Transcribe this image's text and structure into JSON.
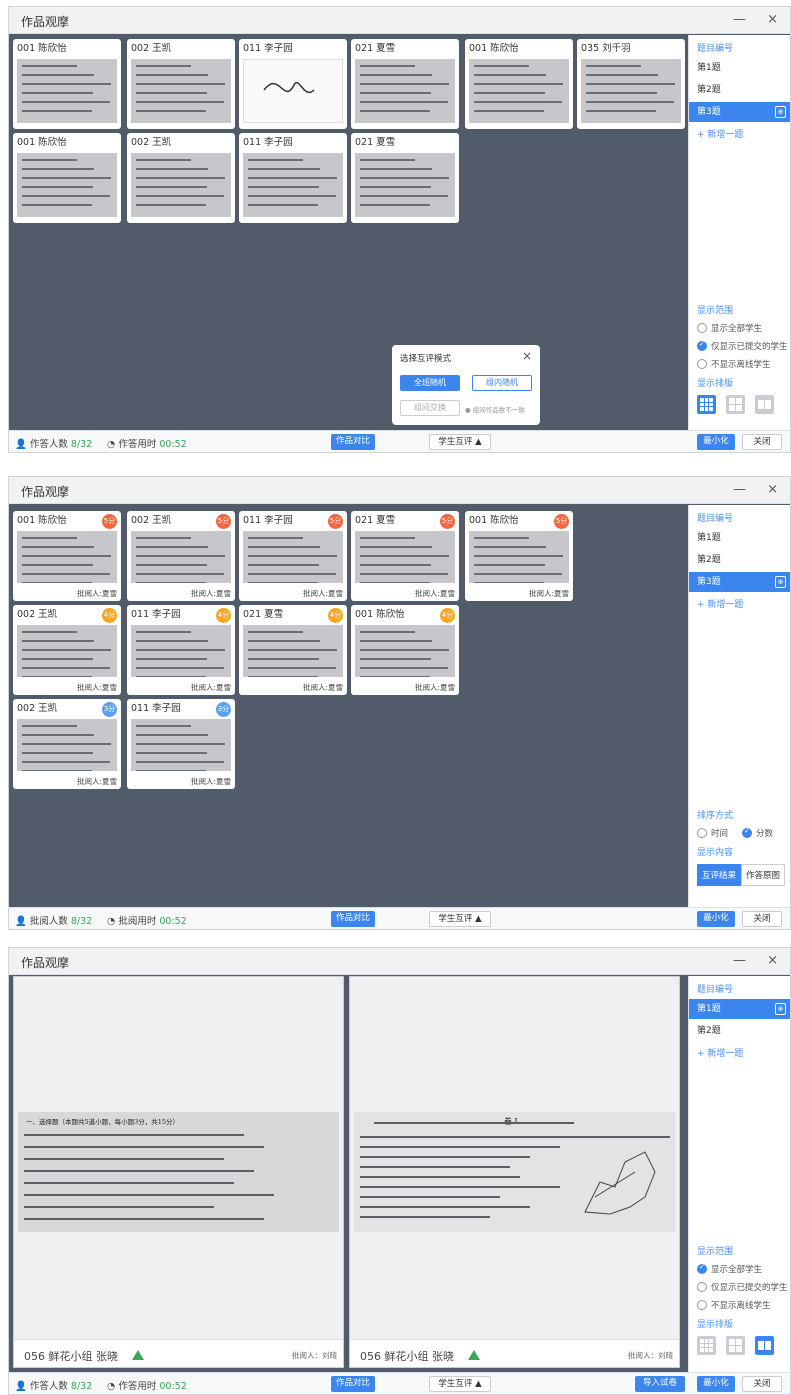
{
  "window": {
    "title": "作品观摩",
    "minimize": "—",
    "close": "×"
  },
  "p1": {
    "cards": [
      {
        "label": "001 陈欣怡"
      },
      {
        "label": "002 王凯"
      },
      {
        "label": "011 李子园"
      },
      {
        "label": "021 夏雪"
      },
      {
        "label": "001 陈欣怡"
      },
      {
        "label": "035 刘千羽"
      },
      {
        "label": "001 陈欣怡"
      },
      {
        "label": "002 王凯"
      },
      {
        "label": "011 李子园"
      },
      {
        "label": "021 夏雪"
      }
    ],
    "sidebar": {
      "header": "题目编号",
      "items": [
        "第1题",
        "第2题",
        "第3题"
      ],
      "add": "+  新增一题",
      "copy_icon": "copy-icon",
      "range_label": "显示范围",
      "range_opts": [
        "显示全部学生",
        "仅显示已提交的学生",
        "不显示离线学生"
      ],
      "layout_label": "显示排版"
    },
    "dialog": {
      "title": "选择互评模式",
      "btn1": "全班随机",
      "btn2": "组内随机",
      "btn3": "组间交换",
      "note": "● 组间作品数不一致"
    },
    "bottom": {
      "count_label": "作答人数",
      "count": "8/32",
      "time_label": "作答用时",
      "time": "00:52",
      "compare": "作品对比",
      "peer": "学生互评 ▲",
      "minimize": "最小化",
      "close": "关闭"
    }
  },
  "p2": {
    "cards": [
      {
        "label": "001 陈欣怡",
        "score": "5分",
        "grader": "批阅人:夏雪"
      },
      {
        "label": "002 王凯",
        "score": "5分",
        "grader": "批阅人:夏雪"
      },
      {
        "label": "011 李子园",
        "score": "5分",
        "grader": "批阅人:夏雪"
      },
      {
        "label": "021 夏雪",
        "score": "5分",
        "grader": "批阅人:夏雪"
      },
      {
        "label": "001 陈欣怡",
        "score": "5分",
        "grader": "批阅人:夏雪"
      },
      {
        "label": "002 王凯",
        "score": "4分",
        "grader": "批阅人:夏雪"
      },
      {
        "label": "011 李子园",
        "score": "4分",
        "grader": "批阅人:夏雪"
      },
      {
        "label": "021 夏雪",
        "score": "4分",
        "grader": "批阅人:夏雪"
      },
      {
        "label": "001 陈欣怡",
        "score": "4分",
        "grader": "批阅人:夏雪"
      },
      {
        "label": "002 王凯",
        "score": "3分",
        "grader": "批阅人:夏雪"
      },
      {
        "label": "011 李子园",
        "score": "3分",
        "grader": "批阅人:夏雪"
      }
    ],
    "sidebar": {
      "header": "题目编号",
      "items": [
        "第1题",
        "第2题",
        "第3题"
      ],
      "add": "+  新增一题",
      "sort_label": "排序方式",
      "sort_opts": [
        "时间",
        "分数"
      ],
      "content_label": "显示内容",
      "content_opts": [
        "互评结果",
        "作答原图"
      ]
    },
    "bottom": {
      "count_label": "批阅人数",
      "count": "8/32",
      "time_label": "批阅用时",
      "time": "00:52",
      "compare": "作品对比",
      "peer": "学生互评 ▲",
      "minimize": "最小化",
      "close": "关闭"
    }
  },
  "p3": {
    "papers": [
      {
        "name": "056 鲜花小组 张晓",
        "grader": "批阅人：刘晴",
        "heading": "一、选择题（本题共5道小题，每小题3分，共15分）"
      },
      {
        "name": "056 鲜花小组 张晓",
        "grader": "批阅人：刘晴",
        "heading": "卷  I"
      }
    ],
    "sidebar": {
      "header": "题目编号",
      "items": [
        "第1题",
        "第2题"
      ],
      "add": "+  新增一题",
      "range_label": "显示范围",
      "range_opts": [
        "显示全部学生",
        "仅显示已提交的学生",
        "不显示离线学生"
      ],
      "layout_label": "显示排版"
    },
    "bottom": {
      "count_label": "作答人数",
      "count": "8/32",
      "time_label": "作答用时",
      "time": "00:52",
      "compare": "作品对比",
      "peer": "学生互评 ▲",
      "import": "导入试卷",
      "minimize": "最小化",
      "close": "关闭"
    }
  },
  "colors": {
    "accent": "#3a86ee",
    "panel_bg": "#525b6a",
    "score_5": "#f4663e",
    "score_4": "#f5a623",
    "score_3": "#5aa0f5",
    "green": "#3aa65a"
  }
}
